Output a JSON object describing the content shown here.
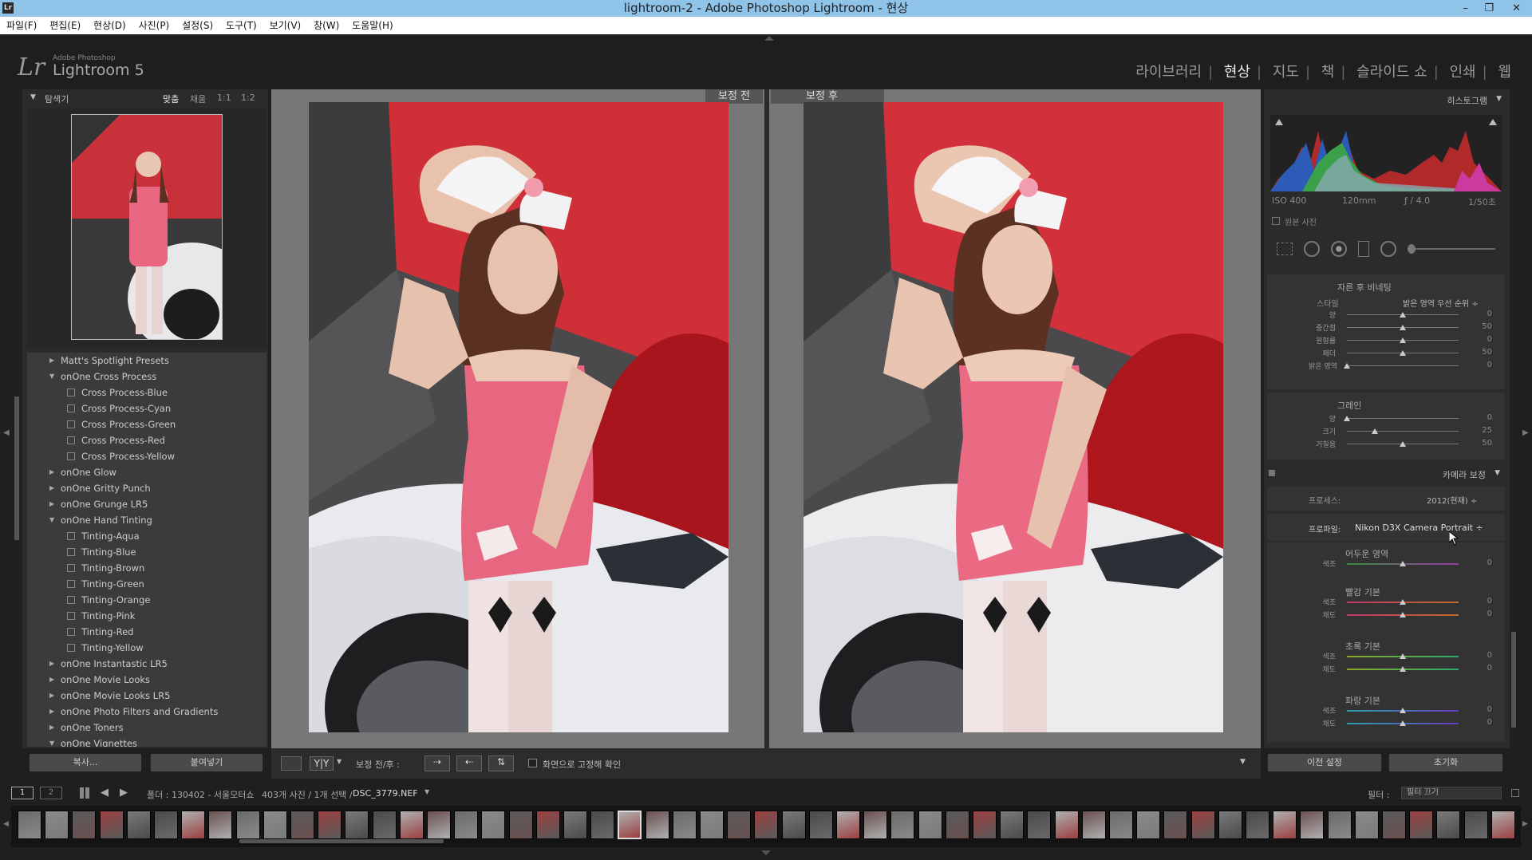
{
  "window": {
    "title": "lightroom-2 - Adobe Photoshop Lightroom - 현상",
    "app_icon": "Lr",
    "minimize": "–",
    "restore": "❐",
    "close": "✕"
  },
  "menu": [
    "파일(F)",
    "편집(E)",
    "현상(D)",
    "사진(P)",
    "설정(S)",
    "도구(T)",
    "보기(V)",
    "창(W)",
    "도움말(H)"
  ],
  "identity": {
    "logo": "Lr",
    "sub": "Adobe Photoshop",
    "name": "Lightroom 5"
  },
  "modules": {
    "items": [
      "라이브러리",
      "현상",
      "지도",
      "책",
      "슬라이드 쇼",
      "인쇄",
      "웹"
    ],
    "active": "현상",
    "separator": "|"
  },
  "navigator": {
    "title": "탐색기",
    "zooms": [
      "맞춤",
      "채움",
      "1:1",
      "1:2"
    ]
  },
  "presets": [
    {
      "label": "Matt's Spotlight Presets",
      "type": "folder",
      "open": false
    },
    {
      "label": "onOne Cross Process",
      "type": "folder",
      "open": true
    },
    {
      "label": "Cross Process-Blue",
      "type": "item"
    },
    {
      "label": "Cross Process-Cyan",
      "type": "item"
    },
    {
      "label": "Cross Process-Green",
      "type": "item"
    },
    {
      "label": "Cross Process-Red",
      "type": "item"
    },
    {
      "label": "Cross Process-Yellow",
      "type": "item"
    },
    {
      "label": "onOne Glow",
      "type": "folder",
      "open": false
    },
    {
      "label": "onOne Gritty Punch",
      "type": "folder",
      "open": false
    },
    {
      "label": "onOne Grunge LR5",
      "type": "folder",
      "open": false
    },
    {
      "label": "onOne Hand Tinting",
      "type": "folder",
      "open": true
    },
    {
      "label": "Tinting-Aqua",
      "type": "item"
    },
    {
      "label": "Tinting-Blue",
      "type": "item"
    },
    {
      "label": "Tinting-Brown",
      "type": "item"
    },
    {
      "label": "Tinting-Green",
      "type": "item"
    },
    {
      "label": "Tinting-Orange",
      "type": "item"
    },
    {
      "label": "Tinting-Pink",
      "type": "item"
    },
    {
      "label": "Tinting-Red",
      "type": "item"
    },
    {
      "label": "Tinting-Yellow",
      "type": "item"
    },
    {
      "label": "onOne Instantastic LR5",
      "type": "folder",
      "open": false
    },
    {
      "label": "onOne Movie Looks",
      "type": "folder",
      "open": false
    },
    {
      "label": "onOne Movie Looks LR5",
      "type": "folder",
      "open": false
    },
    {
      "label": "onOne Photo Filters and Gradients",
      "type": "folder",
      "open": false
    },
    {
      "label": "onOne Toners",
      "type": "folder",
      "open": false
    },
    {
      "label": "onOne Vignettes",
      "type": "folder",
      "open": true
    }
  ],
  "left_buttons": {
    "copy": "복사...",
    "paste": "붙여넣기"
  },
  "compare": {
    "before": "보정 전",
    "after": "보정 후"
  },
  "toolbar": {
    "before_after_label": "보정 전/후 :",
    "yy": "Y|Y",
    "checkbox_label": "화면으로 고정해 확인"
  },
  "histogram": {
    "title": "히스토그램",
    "iso": "ISO 400",
    "focal": "120mm",
    "aperture": "ƒ / 4.0",
    "shutter": "1/50초",
    "original_label": "원본 사진"
  },
  "vignette": {
    "title": "자른 후 비네팅",
    "style_label": "스타일",
    "style_value": "밝은 영역 우선 순위 ÷",
    "sliders": [
      {
        "label": "양",
        "value": "0",
        "pos": 0.5
      },
      {
        "label": "중간점",
        "value": "50",
        "pos": 0.5
      },
      {
        "label": "원형률",
        "value": "0",
        "pos": 0.5
      },
      {
        "label": "페더",
        "value": "50",
        "pos": 0.5
      },
      {
        "label": "밝은 영역",
        "value": "0",
        "pos": 0
      }
    ]
  },
  "grain": {
    "title": "그레인",
    "sliders": [
      {
        "label": "양",
        "value": "0",
        "pos": 0
      },
      {
        "label": "크기",
        "value": "25",
        "pos": 0.25
      },
      {
        "label": "거칠음",
        "value": "50",
        "pos": 0.5
      }
    ]
  },
  "camera_calibration": {
    "title": "카메라 보정",
    "process_label": "프로세스:",
    "process_value": "2012(현재) ÷",
    "profile_label": "프로파일:",
    "profile_value": "Nikon D3X Camera Portrait ÷",
    "shadows": {
      "title": "어두운 영역",
      "sliders": [
        {
          "label": "색조",
          "value": "0",
          "pos": 0.5
        }
      ]
    },
    "red": {
      "title": "빨강 기본",
      "sliders": [
        {
          "label": "색조",
          "value": "0",
          "pos": 0.5
        },
        {
          "label": "채도",
          "value": "0",
          "pos": 0.5
        }
      ]
    },
    "green": {
      "title": "초록 기본",
      "sliders": [
        {
          "label": "색조",
          "value": "0",
          "pos": 0.5
        },
        {
          "label": "채도",
          "value": "0",
          "pos": 0.5
        }
      ]
    },
    "blue": {
      "title": "파랑 기본",
      "sliders": [
        {
          "label": "색조",
          "value": "0",
          "pos": 0.5
        },
        {
          "label": "채도",
          "value": "0",
          "pos": 0.5
        }
      ]
    }
  },
  "right_buttons": {
    "previous": "이전 설정",
    "reset": "초기화"
  },
  "filmstrip": {
    "screen1": "1",
    "screen2": "2",
    "source": "폴더 : 130402 - 서울모터쇼",
    "count": "403개 사진 / 1개 선택 /",
    "filename": "DSC_3779.NEF",
    "filter_label": "필터 :",
    "filter_value": "필터 끄기"
  }
}
